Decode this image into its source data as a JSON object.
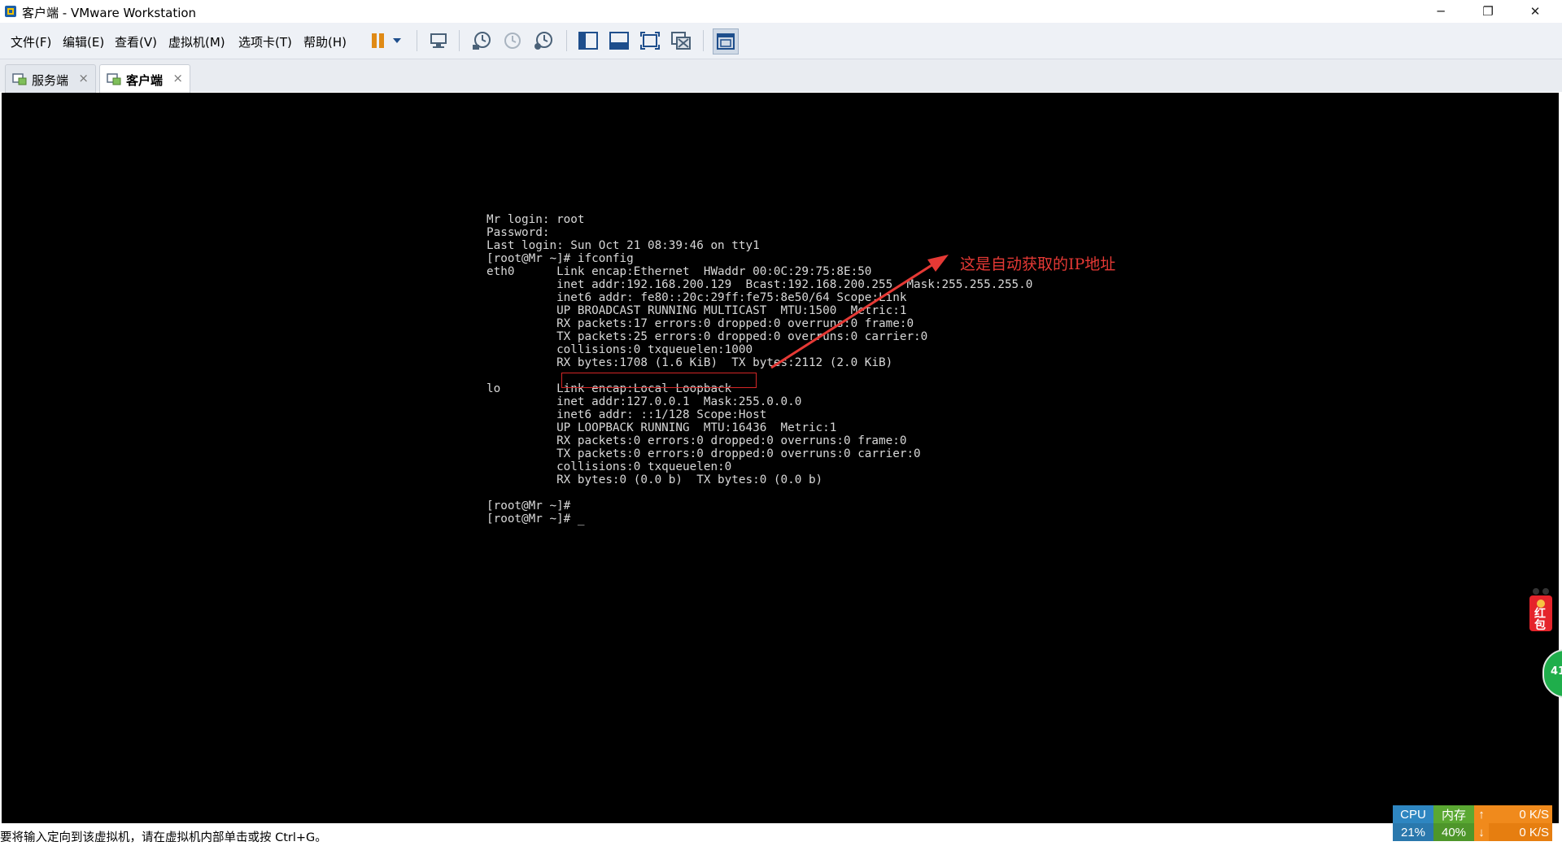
{
  "window": {
    "title": "客户端 - VMware Workstation",
    "minimize": "─",
    "restore": "❐",
    "close": "✕"
  },
  "menu": {
    "items": [
      "文件(F)",
      "编辑(E)",
      "查看(V)",
      "虚拟机(M)",
      "选项卡(T)",
      "帮助(H)"
    ]
  },
  "toolbar": {
    "icons": [
      "pause-icon",
      "dropdown-icon",
      "send-ctrl-alt-del-icon",
      "snapshot-icon",
      "revert-snapshot-icon",
      "snapshot-manager-icon",
      "show-library-icon",
      "thumbnail-bar-icon",
      "full-screen-icon",
      "unity-icon",
      "console-view-icon"
    ]
  },
  "tabs": [
    {
      "label": "服务端",
      "active": false
    },
    {
      "label": "客户端",
      "active": true
    }
  ],
  "terminal": {
    "text": "Mr login: root\nPassword:\nLast login: Sun Oct 21 08:39:46 on tty1\n[root@Mr ~]# ifconfig\neth0      Link encap:Ethernet  HWaddr 00:0C:29:75:8E:50\n          inet addr:192.168.200.129  Bcast:192.168.200.255  Mask:255.255.255.0\n          inet6 addr: fe80::20c:29ff:fe75:8e50/64 Scope:Link\n          UP BROADCAST RUNNING MULTICAST  MTU:1500  Metric:1\n          RX packets:17 errors:0 dropped:0 overruns:0 frame:0\n          TX packets:25 errors:0 dropped:0 overruns:0 carrier:0\n          collisions:0 txqueuelen:1000\n          RX bytes:1708 (1.6 KiB)  TX bytes:2112 (2.0 KiB)\n\nlo        Link encap:Local Loopback\n          inet addr:127.0.0.1  Mask:255.0.0.0\n          inet6 addr: ::1/128 Scope:Host\n          UP LOOPBACK RUNNING  MTU:16436  Metric:1\n          RX packets:0 errors:0 dropped:0 overruns:0 frame:0\n          TX packets:0 errors:0 dropped:0 overruns:0 carrier:0\n          collisions:0 txqueuelen:0\n          RX bytes:0 (0.0 b)  TX bytes:0 (0.0 b)\n\n[root@Mr ~]#\n[root@Mr ~]# _"
  },
  "annotation": {
    "text": "这是自动获取的IP地址",
    "color": "#e53935"
  },
  "floating": {
    "redpacket_label": "红包",
    "green_badge": "41"
  },
  "status": {
    "text": "要将输入定向到该虚拟机，请在虚拟机内部单击或按 Ctrl+G。"
  },
  "monitor": {
    "cpu_label": "CPU",
    "cpu_value": "21%",
    "mem_label": "内存",
    "mem_value": "40%",
    "up_speed": "0 K/S",
    "down_speed": "0 K/S",
    "colors": {
      "cpu": "#2e86c1",
      "mem": "#5aa832",
      "net": "#f08a1c"
    }
  }
}
